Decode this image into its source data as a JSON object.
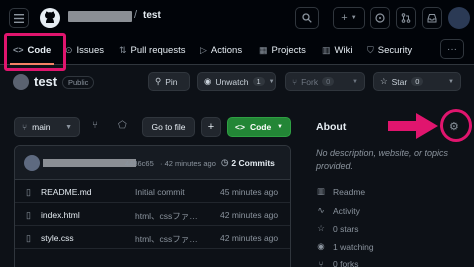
{
  "header": {
    "owner_hidden": "",
    "separator": "/",
    "repo": "test",
    "icons": [
      "hamburger-icon",
      "github-logo-icon",
      "search-icon",
      "plus-icon",
      "issue-icon",
      "pull-request-icon",
      "inbox-icon"
    ]
  },
  "nav": {
    "tabs": [
      {
        "label": "Code",
        "icon": "code-icon"
      },
      {
        "label": "Issues",
        "icon": "issue-icon"
      },
      {
        "label": "Pull requests",
        "icon": "pull-request-icon"
      },
      {
        "label": "Actions",
        "icon": "play-icon"
      },
      {
        "label": "Projects",
        "icon": "table-icon"
      },
      {
        "label": "Wiki",
        "icon": "book-icon"
      },
      {
        "label": "Security",
        "icon": "shield-icon"
      }
    ],
    "more": "···"
  },
  "repo": {
    "name": "test",
    "visibility": "Public",
    "pin_label": "Pin",
    "watch_label": "Unwatch",
    "watch_count": "1",
    "fork_label": "Fork",
    "fork_count": "0",
    "star_label": "Star",
    "star_count": "0"
  },
  "controls": {
    "branch": "main",
    "goto_file": "Go to file",
    "add": "+",
    "code_button": "Code"
  },
  "commit": {
    "sha": "4486c65",
    "time": "· 42 minutes ago",
    "count": "2 Commits"
  },
  "files": [
    {
      "name": "README.md",
      "message": "Initial commit",
      "time": "45 minutes ago"
    },
    {
      "name": "index.html",
      "message": "html、cssファ…",
      "time": "42 minutes ago"
    },
    {
      "name": "style.css",
      "message": "html、cssファ…",
      "time": "42 minutes ago"
    }
  ],
  "about": {
    "title": "About",
    "description": "No description, website, or topics provided.",
    "items": [
      {
        "label": "Readme",
        "icon": "book-icon"
      },
      {
        "label": "Activity",
        "icon": "pulse-icon"
      },
      {
        "label": "0 stars",
        "icon": "star-icon"
      },
      {
        "label": "1 watching",
        "icon": "eye-icon"
      },
      {
        "label": "0 forks",
        "icon": "fork-icon"
      }
    ]
  },
  "colors": {
    "background": "#0d1117",
    "header": "#010409",
    "accent_green": "#238636",
    "annotation_pink": "#e0156e",
    "tab_underline": "#f78166"
  }
}
